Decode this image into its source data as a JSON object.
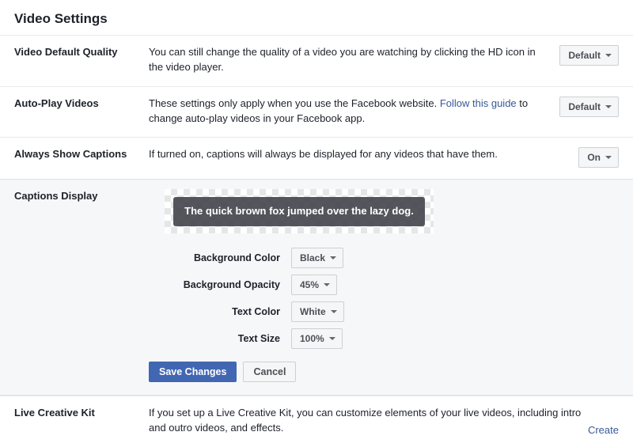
{
  "page": {
    "title": "Video Settings"
  },
  "rows": {
    "quality": {
      "label": "Video Default Quality",
      "desc": "You can still change the quality of a video you are watching by clicking the HD icon in the video player.",
      "value": "Default"
    },
    "autoplay": {
      "label": "Auto-Play Videos",
      "desc_pre": "These settings only apply when you use the Facebook website. ",
      "link": "Follow this guide",
      "desc_post": " to change auto-play videos in your Facebook app.",
      "value": "Default"
    },
    "captions_toggle": {
      "label": "Always Show Captions",
      "desc": "If turned on, captions will always be displayed for any videos that have them.",
      "value": "On"
    },
    "captions_display": {
      "label": "Captions Display",
      "sample": "The quick brown fox jumped over the lazy dog.",
      "options": {
        "bg_color": {
          "label": "Background Color",
          "value": "Black"
        },
        "bg_opacity": {
          "label": "Background Opacity",
          "value": "45%"
        },
        "text_color": {
          "label": "Text Color",
          "value": "White"
        },
        "text_size": {
          "label": "Text Size",
          "value": "100%"
        }
      },
      "save": "Save Changes",
      "cancel": "Cancel"
    },
    "live_kit": {
      "label": "Live Creative Kit",
      "desc": "If you set up a Live Creative Kit, you can customize elements of your live videos, including intro and outro videos, and effects.",
      "action": "Create"
    }
  }
}
